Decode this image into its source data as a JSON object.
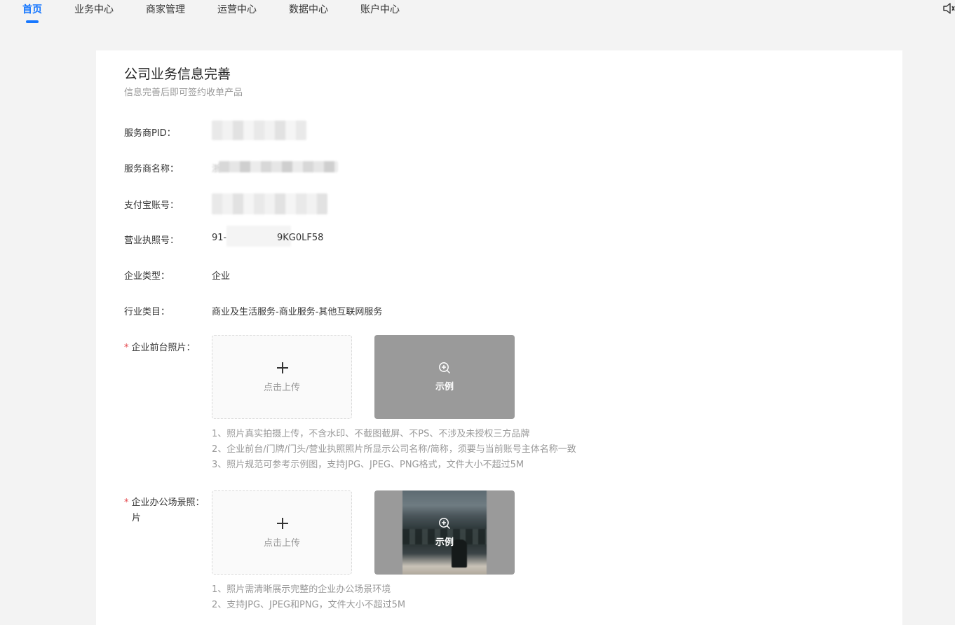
{
  "nav": {
    "items": [
      "首页",
      "业务中心",
      "商家管理",
      "运营中心",
      "数据中心",
      "账户中心"
    ]
  },
  "page": {
    "title": "公司业务信息完善",
    "subtitle": "信息完善后即可签约收单产品"
  },
  "fields": {
    "pid_label": "服务商PID：",
    "name_label": "服务商名称：",
    "name_value_visible_char": "浙",
    "alipay_label": "支付宝账号：",
    "license_label": "营业执照号：",
    "license_prefix": "91-",
    "license_suffix": "9KG0LF58",
    "type_label": "企业类型：",
    "type_value": "企业",
    "category_label": "行业类目：",
    "category_value": "商业及生活服务-商业服务-其他互联网服务"
  },
  "front_photo": {
    "required_mark": "*",
    "label": "企业前台照片：",
    "upload_text": "点击上传",
    "example_text": "示例",
    "hints": [
      "1、照片真实拍摄上传，不含水印、不截图截屏、不PS、不涉及未授权三方品牌",
      "2、企业前台/门牌/门头/营业执照照片所显示公司名称/简称，须要与当前账号主体名称一致",
      "3、照片规范可参考示例图，支持JPG、JPEG、PNG格式，文件大小不超过5M"
    ]
  },
  "office_photo": {
    "required_mark": "*",
    "label_line1": "企业办公场景照",
    "label_line1_colon": "：",
    "label_line2": "片",
    "upload_text": "点击上传",
    "example_text": "示例",
    "hints": [
      "1、照片需清晰展示完整的企业办公场景环境",
      "2、支持JPG、JPEG和PNG，文件大小不超过5M"
    ]
  },
  "colors": {
    "accent": "#1677ff",
    "required": "#e5484d",
    "hint": "#999999",
    "example_bg": "#9a9a9a"
  }
}
